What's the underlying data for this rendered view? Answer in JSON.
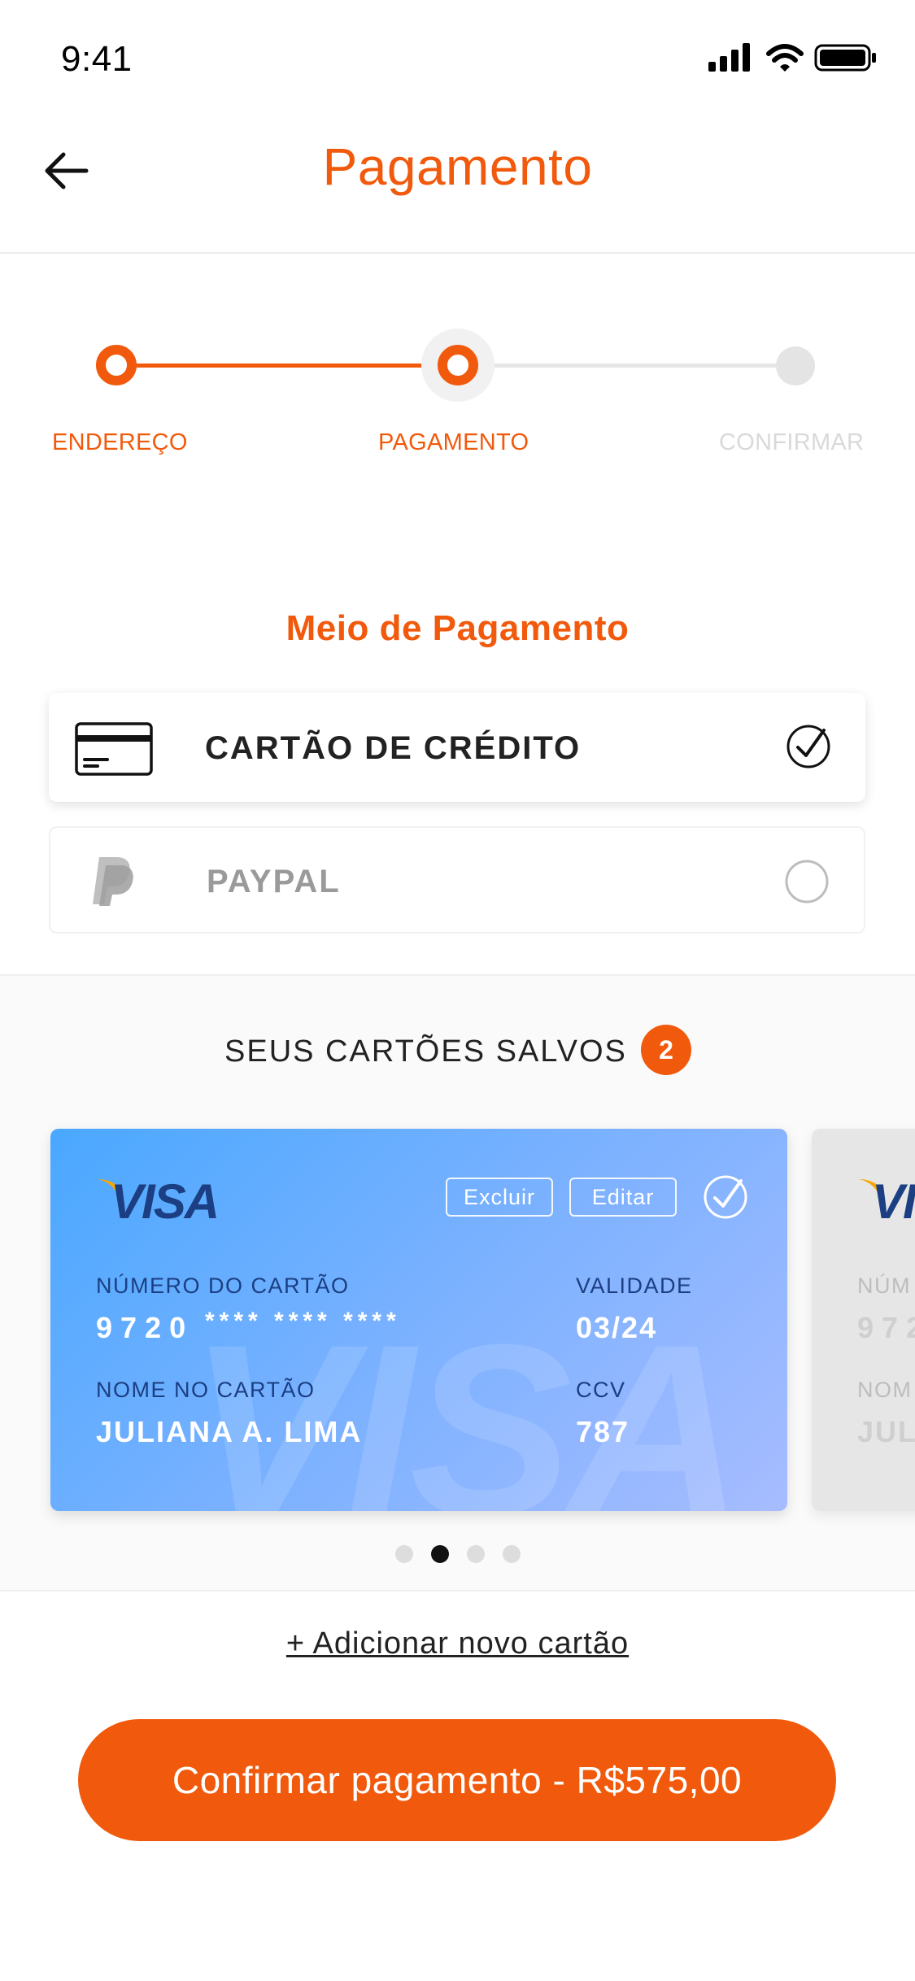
{
  "status_bar": {
    "time": "9:41",
    "icons": [
      "signal-icon",
      "wifi-icon",
      "battery-icon"
    ]
  },
  "header": {
    "title": "Pagamento",
    "back_icon": "arrow-left-icon"
  },
  "stepper": {
    "steps": [
      {
        "label": "ENDEREÇO",
        "state": "done"
      },
      {
        "label": "PAGAMENTO",
        "state": "current"
      },
      {
        "label": "CONFIRMAR",
        "state": "pending"
      }
    ]
  },
  "payment_methods": {
    "title": "Meio de Pagamento",
    "options": [
      {
        "label": "CARTÃO DE CRÉDITO",
        "icon": "credit-card-icon",
        "selected": true
      },
      {
        "label": "PAYPAL",
        "icon": "paypal-icon",
        "selected": false
      }
    ]
  },
  "saved_cards": {
    "title": "SEUS CARTÕES SALVOS",
    "count": "2",
    "cards": [
      {
        "brand": "VISA",
        "delete_label": "Excluir",
        "edit_label": "Editar",
        "number_label": "NÚMERO DO CARTÃO",
        "number_start": "9720",
        "number_masked": "**** **** ****",
        "validity_label": "VALIDADE",
        "validity": "03/24",
        "name_label": "NOME NO CARTÃO",
        "name": "JULIANA A. LIMA",
        "ccv_label": "CCV",
        "ccv": "787"
      },
      {
        "brand": "VI",
        "number_label": "NÚM",
        "number_start": "972",
        "name_label": "NOM",
        "name": "JUL"
      }
    ],
    "pager": {
      "pages": 4,
      "active": 2
    }
  },
  "actions": {
    "add_card": "+ Adicionar novo cartão",
    "confirm": "Confirmar pagamento - R$575,00"
  },
  "colors": {
    "accent": "#f15a0c",
    "card_gradient_start": "#4aa8ff",
    "card_gradient_end": "#a7bcff",
    "visa_blue": "#1b3f82",
    "visa_gold": "#f7a600"
  }
}
